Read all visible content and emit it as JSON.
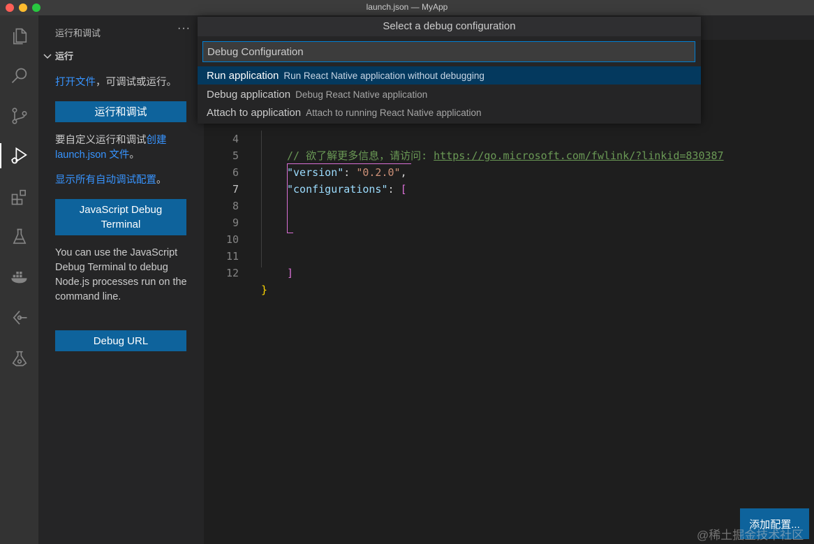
{
  "window": {
    "title": "launch.json — MyApp"
  },
  "sidebar": {
    "header": "运行和调试",
    "more": "···",
    "section_title": "运行",
    "open_file_link": "打开文件",
    "open_file_suffix": "，可调试或运行。",
    "run_debug_button": "运行和调试",
    "customize_prefix": "要自定义运行和调试",
    "create_link": "创建 launch.json 文件",
    "customize_suffix": "。",
    "show_all_link": "显示所有自动调试配置",
    "show_all_suffix": "。",
    "js_terminal_button": "JavaScript Debug Terminal",
    "js_terminal_description": "You can use the JavaScript Debug Terminal to debug Node.js processes run on the command line.",
    "debug_url_button": "Debug URL"
  },
  "editor": {
    "lines": [
      {
        "num": "4",
        "comment": "// 欲了解更多信息，请访问: ",
        "url": "https://go.microsoft.com/fwlink/?linkid=830387"
      },
      {
        "num": "5",
        "key": "\"version\"",
        "colon": ": ",
        "value": "\"0.2.0\"",
        "tail": ","
      },
      {
        "num": "6",
        "key": "\"configurations\"",
        "colon": ": ",
        "bracket": "["
      },
      {
        "num": "7"
      },
      {
        "num": "8"
      },
      {
        "num": "9"
      },
      {
        "num": "10"
      },
      {
        "num": "11",
        "bracket": "]"
      },
      {
        "num": "12",
        "brace": "}"
      }
    ]
  },
  "quickpick": {
    "title": "Select a debug configuration",
    "placeholder": "Debug Configuration",
    "items": [
      {
        "label": "Run application",
        "description": "Run React Native application without debugging"
      },
      {
        "label": "Debug application",
        "description": "Debug React Native application"
      },
      {
        "label": "Attach to application",
        "description": "Attach to running React Native application"
      }
    ]
  },
  "add_config_button": "添加配置...",
  "watermark": "@稀土掘金技术社区"
}
